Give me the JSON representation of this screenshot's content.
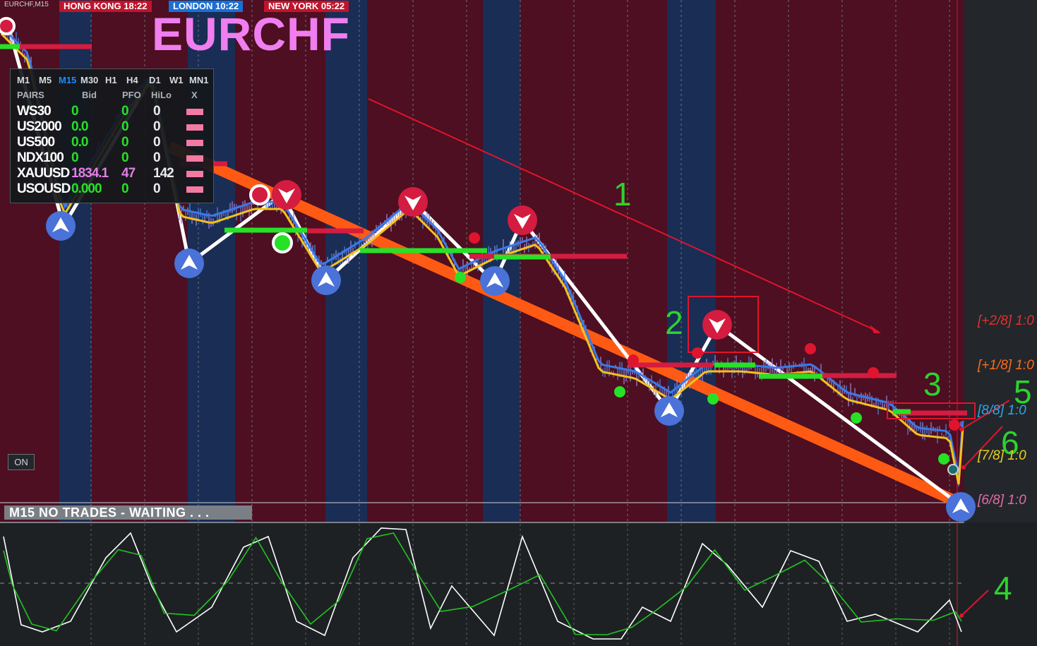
{
  "chart": {
    "symbol_label": "EURCHF,M15",
    "title": "EURCHF",
    "sessions": [
      {
        "name": "HONG KONG",
        "time": "18:22",
        "color": "#c0142c"
      },
      {
        "name": "LONDON",
        "time": "10:22",
        "color": "#1a6fd6"
      },
      {
        "name": "NEW YORK",
        "time": "05:22",
        "color": "#c0142c"
      }
    ],
    "on_button": "ON",
    "status_text": "M15  NO TRADES - WAITING . . ."
  },
  "dashboard": {
    "timeframes": [
      "M1",
      "M5",
      "M15",
      "M30",
      "H1",
      "H4",
      "D1",
      "W1",
      "MN1"
    ],
    "active_timeframe": "M15",
    "headers": [
      "PAIRS",
      "Bid",
      "PFO",
      "HiLo",
      "X"
    ],
    "rows": [
      {
        "pair": "WS30",
        "bid": "0",
        "pfo": "0",
        "hilo": "0"
      },
      {
        "pair": "US2000",
        "bid": "0.0",
        "pfo": "0",
        "hilo": "0"
      },
      {
        "pair": "US500",
        "bid": "0.0",
        "pfo": "0",
        "hilo": "0"
      },
      {
        "pair": "NDX100",
        "bid": "0",
        "pfo": "0",
        "hilo": "0"
      },
      {
        "pair": "XAUUSD",
        "bid": "1834.1",
        "pfo": "47",
        "hilo": "142"
      },
      {
        "pair": "USOUSD",
        "bid": "0.000",
        "pfo": "0",
        "hilo": "0"
      }
    ]
  },
  "annotations": [
    "1",
    "2",
    "3",
    "4",
    "5",
    "6"
  ],
  "murrey_levels": [
    {
      "label": "[+2/8]  1:0",
      "color": "#e0322e"
    },
    {
      "label": "[+1/8]  1:0",
      "color": "#ff6a1a"
    },
    {
      "label": "[8/8]  1:0",
      "color": "#2aa8e8"
    },
    {
      "label": "[7/8]  1:0",
      "color": "#e8d21e"
    },
    {
      "label": "[6/8]  1:0",
      "color": "#e86aa8"
    }
  ],
  "colors": {
    "bear_zone": "#4d0f21",
    "bull_zone": "#1a2d55",
    "channel": "#ff5a14",
    "signal_green": "#27e127",
    "resistance": "#d41c40"
  }
}
